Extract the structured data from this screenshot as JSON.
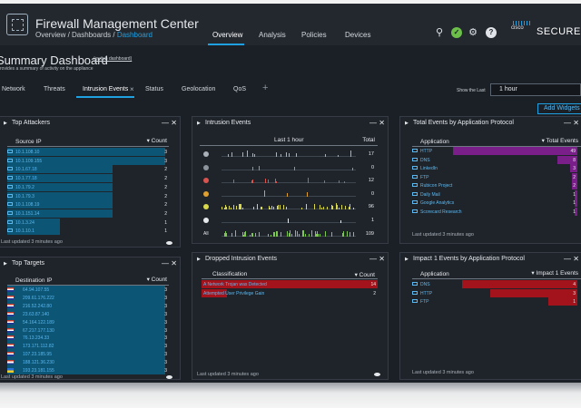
{
  "header": {
    "app_title": "Firewall Management Center",
    "breadcrumb": [
      "Overview",
      "Dashboards",
      "Dashboard"
    ],
    "nav": [
      "Overview",
      "Analysis",
      "Policies",
      "Devices"
    ],
    "active_nav": "Overview",
    "brand_small": "cisco",
    "brand": "SECURE",
    "icons": [
      "search-icon",
      "check-status-icon",
      "gear-icon",
      "help-icon"
    ]
  },
  "dashboard": {
    "title": "Summary Dashboard",
    "switch_link": "(switch dashboard)",
    "subtitle": "rovides a summary of activity on the appliance",
    "tabs": [
      "Network",
      "Threats",
      "Intrusion Events",
      "Status",
      "Geolocation",
      "QoS"
    ],
    "active_tab": "Intrusion Events",
    "show_last_label": "Show the Last",
    "show_last_value": "1 hour",
    "add_widgets": "Add Widgets"
  },
  "colors": {
    "accent": "#1fa0e0",
    "teal_bar": "#0d5575",
    "magenta_bar": "#7a1f8a",
    "red_bar": "#a3131b",
    "status_green": "#6cc04a"
  },
  "widgets": {
    "top_attackers": {
      "title": "Top Attackers",
      "col1": "Source IP",
      "col2": "Count",
      "rows": [
        {
          "label": "10.1.108.10",
          "count": 3
        },
        {
          "label": "10.1.109.155",
          "count": 3
        },
        {
          "label": "10.1.67.18",
          "count": 2
        },
        {
          "label": "10.1.77.18",
          "count": 2
        },
        {
          "label": "10.1.79.2",
          "count": 2
        },
        {
          "label": "10.1.79.3",
          "count": 2
        },
        {
          "label": "10.1.108.19",
          "count": 2
        },
        {
          "label": "10.1.151.14",
          "count": 2
        },
        {
          "label": "10.1.3.24",
          "count": 1
        },
        {
          "label": "10.1.10.1",
          "count": 1
        }
      ],
      "footer": "Last updated 3 minutes ago"
    },
    "top_targets": {
      "title": "Top Targets",
      "col1": "Destination IP",
      "col2": "Count",
      "rows": [
        {
          "label": "64.94.107.55",
          "count": 3,
          "flag": "us"
        },
        {
          "label": "209.61.176.222",
          "count": 3,
          "flag": "us"
        },
        {
          "label": "216.52.242.80",
          "count": 3,
          "flag": "us"
        },
        {
          "label": "23.63.87.140",
          "count": 3,
          "flag": "us"
        },
        {
          "label": "54.164.122.189",
          "count": 3,
          "flag": "us"
        },
        {
          "label": "67.217.177.130",
          "count": 3,
          "flag": "us"
        },
        {
          "label": "76.13.234.33",
          "count": 3,
          "flag": "us"
        },
        {
          "label": "173.171.112.82",
          "count": 3,
          "flag": "us"
        },
        {
          "label": "107.23.185.95",
          "count": 3,
          "flag": "us"
        },
        {
          "label": "188.121.36.230",
          "count": 3,
          "flag": "nl"
        },
        {
          "label": "193.23.181.155",
          "count": 3,
          "flag": "ua"
        }
      ],
      "footer": "Last updated 3 minutes ago"
    },
    "intrusion_events": {
      "title": "Intrusion Events",
      "column_time": "Last 1 hour",
      "column_total": "Total",
      "rows": [
        {
          "label": "",
          "icon": "glass-icon",
          "color": "#aab1b8",
          "total": "17",
          "density": 0.2
        },
        {
          "label": "",
          "icon": "priority-0-icon",
          "color": "#8c949c",
          "total": "0",
          "density": 0.05
        },
        {
          "label": "",
          "icon": "priority-1-icon",
          "color": "#d9534f",
          "total": "12",
          "density": 0.15
        },
        {
          "label": "",
          "icon": "priority-2-icon",
          "color": "#e0a030",
          "total": "0",
          "density": 0.04
        },
        {
          "label": "",
          "icon": "priority-3-icon",
          "color": "#d8d84a",
          "total": "96",
          "density": 0.7
        },
        {
          "label": "",
          "icon": "priority-4-icon",
          "color": "#e6e9ec",
          "total": "1",
          "density": 0.03
        },
        {
          "label": "All",
          "icon": "",
          "color": "#7ec850",
          "total": "109",
          "density": 0.8
        }
      ],
      "footer": ""
    },
    "dropped_intrusion": {
      "title": "Dropped Intrusion Events",
      "col1": "Classification",
      "col2": "Count",
      "rows": [
        {
          "label": "A Network Trojan was Detected",
          "count": 14
        },
        {
          "label": "Attempted User Privilege Gain",
          "count": 2
        }
      ],
      "footer": "Last updated 3 minutes ago"
    },
    "total_by_app": {
      "title": "Total Events by Application Protocol",
      "col1": "Application",
      "col2": "Total Events",
      "rows": [
        {
          "label": "HTTP",
          "count": 49
        },
        {
          "label": "DNS",
          "count": 8
        },
        {
          "label": "LinkedIn",
          "count": 3
        },
        {
          "label": "FTP",
          "count": 2
        },
        {
          "label": "Rubicon Project",
          "count": 2
        },
        {
          "label": "Daily Mail",
          "count": 1
        },
        {
          "label": "Google Analytics",
          "count": 1
        },
        {
          "label": "Scorecard Research",
          "count": 1
        }
      ],
      "footer": "Last updated 3 minutes ago"
    },
    "impact1_by_app": {
      "title": "Impact 1 Events by Application Protocol",
      "col1": "Application",
      "col2": "Impact 1 Events",
      "rows": [
        {
          "label": "DNS",
          "count": 4
        },
        {
          "label": "HTTP",
          "count": 3
        },
        {
          "label": "FTP",
          "count": 1
        }
      ],
      "footer": "Last updated 3 minutes ago"
    }
  }
}
